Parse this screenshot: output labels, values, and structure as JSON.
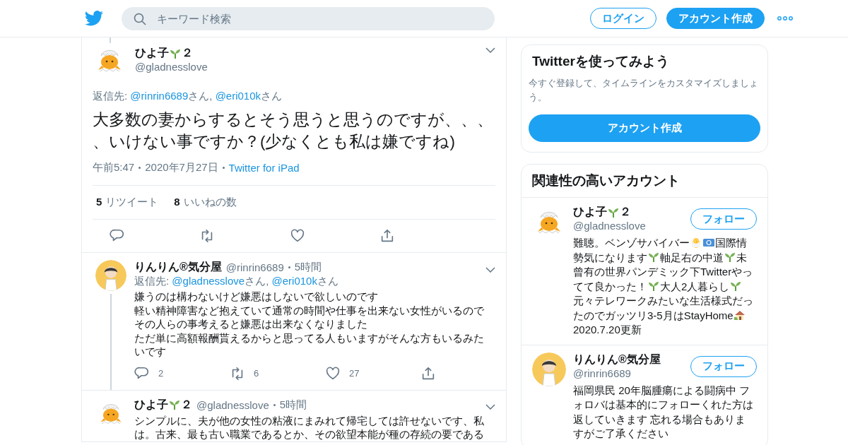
{
  "header": {
    "search_placeholder": "キーワード検索",
    "login": "ログイン",
    "signup": "アカウント作成"
  },
  "main_tweet": {
    "avatar": {
      "kind": "picture"
    },
    "name": [
      {
        "kind": "text",
        "text": "ひよ子"
      },
      {
        "kind": "sprout"
      },
      {
        "kind": "text",
        "text": "２"
      }
    ],
    "handle": "@gladnesslove",
    "reply_to": {
      "label": "返信先:",
      "mentions": [
        {
          "handle": "@rinrin6689",
          "suffix": "さん,"
        },
        {
          "handle": "@eri010k",
          "suffix": "さん"
        }
      ]
    },
    "text": "大多数の妻からするとそう思うと思うのですが、、、、いけない事ですか？(少なくとも私は嫌ですね)",
    "time": "午前5:47",
    "date": "2020年7月27日",
    "source": "Twitter for iPad",
    "stats": [
      {
        "count": "5",
        "label": "リツイート"
      },
      {
        "count": "8",
        "label": "いいねの数"
      }
    ]
  },
  "replies": [
    {
      "avatar": {
        "kind": "picture"
      },
      "name": [
        {
          "kind": "text",
          "text": "りんりん®気分屋"
        }
      ],
      "handle": "@rinrin6689",
      "age": "5時間",
      "reply_to": {
        "label": "返信先:",
        "mentions": [
          {
            "handle": "@gladnesslove",
            "suffix": "さん,"
          },
          {
            "handle": "@eri010k",
            "suffix": "さん"
          }
        ]
      },
      "text_lines": [
        "嫌うのは構わないけど嫌悪はしないで欲しいのです",
        "軽い精神障害など抱えていて通常の時間や仕事を出来ない女性がいるので",
        "その人らの事考えると嫌悪は出来なくなりました",
        "ただ単に高額報酬貰えるからと思ってる人もいますがそんな方もいるみたいです"
      ],
      "replies": "2",
      "retweets": "6",
      "likes": "27"
    },
    {
      "avatar": {
        "kind": "picture"
      },
      "name": [
        {
          "kind": "text",
          "text": "ひよ子"
        },
        {
          "kind": "sprout"
        },
        {
          "kind": "text",
          "text": "２"
        }
      ],
      "handle": "@gladnesslove",
      "age": "5時間",
      "text_lines": [
        "シンプルに、夫が他の女性の粘液にまみれて帰宅しては許せないです、私は。古来、最も古い職業であるとか、その欲望本能が種の存続の要である"
      ]
    }
  ],
  "sidebar": {
    "signup_card": {
      "title": "Twitterを使ってみよう",
      "description": "今すぐ登録して、タイムラインをカスタマイズしましょう。",
      "button": "アカウント作成"
    },
    "related": {
      "title": "関連性の高いアカウント",
      "accounts": [
        {
          "avatar": {
            "kind": "picture"
          },
          "name": [
            {
              "kind": "text",
              "text": "ひよ子"
            },
            {
              "kind": "sprout"
            },
            {
              "kind": "text",
              "text": "２"
            }
          ],
          "handle": "@gladnesslove",
          "follow": "フォロー",
          "bio": [
            {
              "kind": "text",
              "text": "難聴。ベンゾサバイバー"
            },
            {
              "kind": "chick"
            },
            {
              "kind": "flag"
            },
            {
              "kind": "text",
              "text": "国際情勢気になります"
            },
            {
              "kind": "sprout"
            },
            {
              "kind": "text",
              "text": "軸足右の中道"
            },
            {
              "kind": "sprout"
            },
            {
              "kind": "text",
              "text": "未曾有の世界パンデミック下Twitterやってて良かった！"
            },
            {
              "kind": "sprout"
            },
            {
              "kind": "text",
              "text": "大人2人暮らし"
            },
            {
              "kind": "sprout"
            },
            {
              "kind": "text",
              "text": "元々テレワークみたいな生活様式だったのでガッツリ3-5月はStayHome"
            },
            {
              "kind": "house"
            },
            {
              "kind": "text",
              "text": "2020.7.20更新"
            }
          ]
        },
        {
          "avatar": {
            "kind": "picture"
          },
          "name": [
            {
              "kind": "text",
              "text": "りんりん®気分屋"
            }
          ],
          "handle": "@rinrin6689",
          "follow": "フォロー",
          "bio": [
            {
              "kind": "text",
              "text": "福岡県民 20年脳腫瘍による闘病中 フォロバは基本的にフォローくれた方は返していきます 忘れる場合もありますがご了承ください"
            }
          ]
        }
      ]
    }
  }
}
